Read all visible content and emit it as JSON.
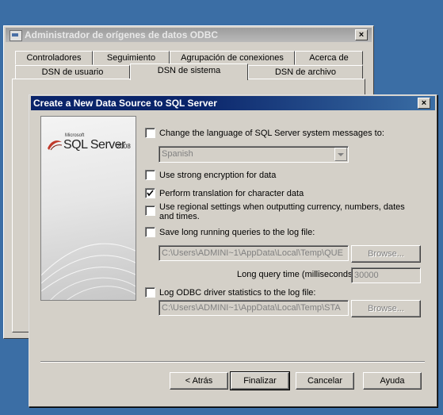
{
  "odbc": {
    "title": "Administrador de orígenes de datos ODBC",
    "tabs_row1": [
      "Controladores",
      "Seguimiento",
      "Agrupación de conexiones",
      "Acerca de"
    ],
    "tabs_row2": [
      "DSN de usuario",
      "DSN de sistema",
      "DSN de archivo"
    ],
    "close": "×"
  },
  "dialog": {
    "title": "Create a New Data Source to SQL Server",
    "close": "×",
    "logo": {
      "brand_small": "Microsoft",
      "product": "SQL Server",
      "version": "2008"
    },
    "options": {
      "change_language": {
        "label": "Change the language of SQL Server system messages to:",
        "checked": false
      },
      "language_value": "Spanish",
      "strong_encryption": {
        "label": "Use strong encryption for data",
        "checked": false
      },
      "translation": {
        "label": "Perform translation for character data",
        "checked": true
      },
      "regional": {
        "label": "Use regional settings when outputting currency, numbers, dates and times.",
        "checked": false
      },
      "long_queries": {
        "label": "Save long running queries to the log file:",
        "checked": false
      },
      "long_queries_path": "C:\\Users\\ADMINI~1\\AppData\\Local\\Temp\\QUE",
      "browse1": "Browse...",
      "long_query_time_label": "Long query time (milliseconds):",
      "long_query_time_value": "30000",
      "odbc_stats": {
        "label": "Log ODBC driver statistics to the log file:",
        "checked": false
      },
      "odbc_stats_path": "C:\\Users\\ADMINI~1\\AppData\\Local\\Temp\\STA",
      "browse2": "Browse..."
    },
    "buttons": {
      "back": "< Atrás",
      "finish": "Finalizar",
      "cancel": "Cancelar",
      "help": "Ayuda"
    }
  }
}
